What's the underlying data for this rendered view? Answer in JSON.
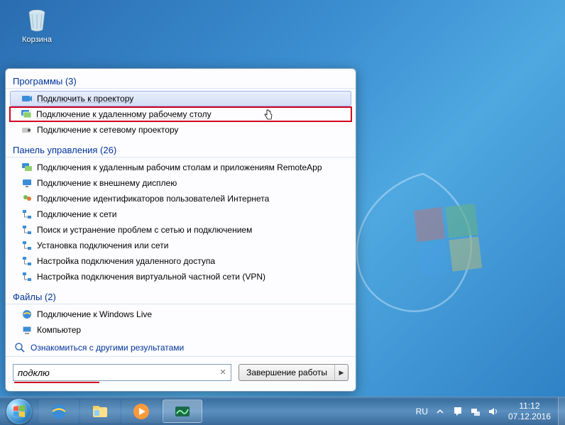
{
  "desktop": {
    "recycle_bin_label": "Корзина"
  },
  "start_panel": {
    "sections": {
      "programs": {
        "title": "Программы (3)"
      },
      "control_panel": {
        "title": "Панель управления (26)"
      },
      "files": {
        "title": "Файлы (2)"
      }
    },
    "programs": [
      {
        "label": "Подключить к проектору",
        "icon": "projector-icon",
        "state": "hover"
      },
      {
        "label": "Подключение к удаленному рабочему столу",
        "icon": "rdp-icon",
        "state": "highlighted"
      },
      {
        "label": "Подключение к сетевому проектору",
        "icon": "net-projector-icon",
        "state": "normal"
      }
    ],
    "control_panel": [
      {
        "label": "Подключения к удаленным рабочим столам и приложениям RemoteApp",
        "icon": "rdp-icon"
      },
      {
        "label": "Подключение к внешнему дисплею",
        "icon": "display-icon"
      },
      {
        "label": "Подключение идентификаторов пользователей Интернета",
        "icon": "users-icon"
      },
      {
        "label": "Подключение к сети",
        "icon": "network-icon"
      },
      {
        "label": "Поиск и устранение проблем с сетью и подключением",
        "icon": "network-icon"
      },
      {
        "label": "Установка подключения или сети",
        "icon": "network-icon"
      },
      {
        "label": "Настройка подключения удаленного доступа",
        "icon": "network-icon"
      },
      {
        "label": "Настройка подключения виртуальной частной сети (VPN)",
        "icon": "network-icon"
      }
    ],
    "files": [
      {
        "label": "Подключение к Windows Live",
        "icon": "ie-icon"
      },
      {
        "label": "Компьютер",
        "icon": "computer-icon"
      }
    ],
    "see_more_label": "Ознакомиться с другими результатами",
    "search_value": "подклю",
    "shutdown_label": "Завершение работы"
  },
  "taskbar": {
    "lang": "RU",
    "time": "11:12",
    "date": "07.12.2016"
  }
}
